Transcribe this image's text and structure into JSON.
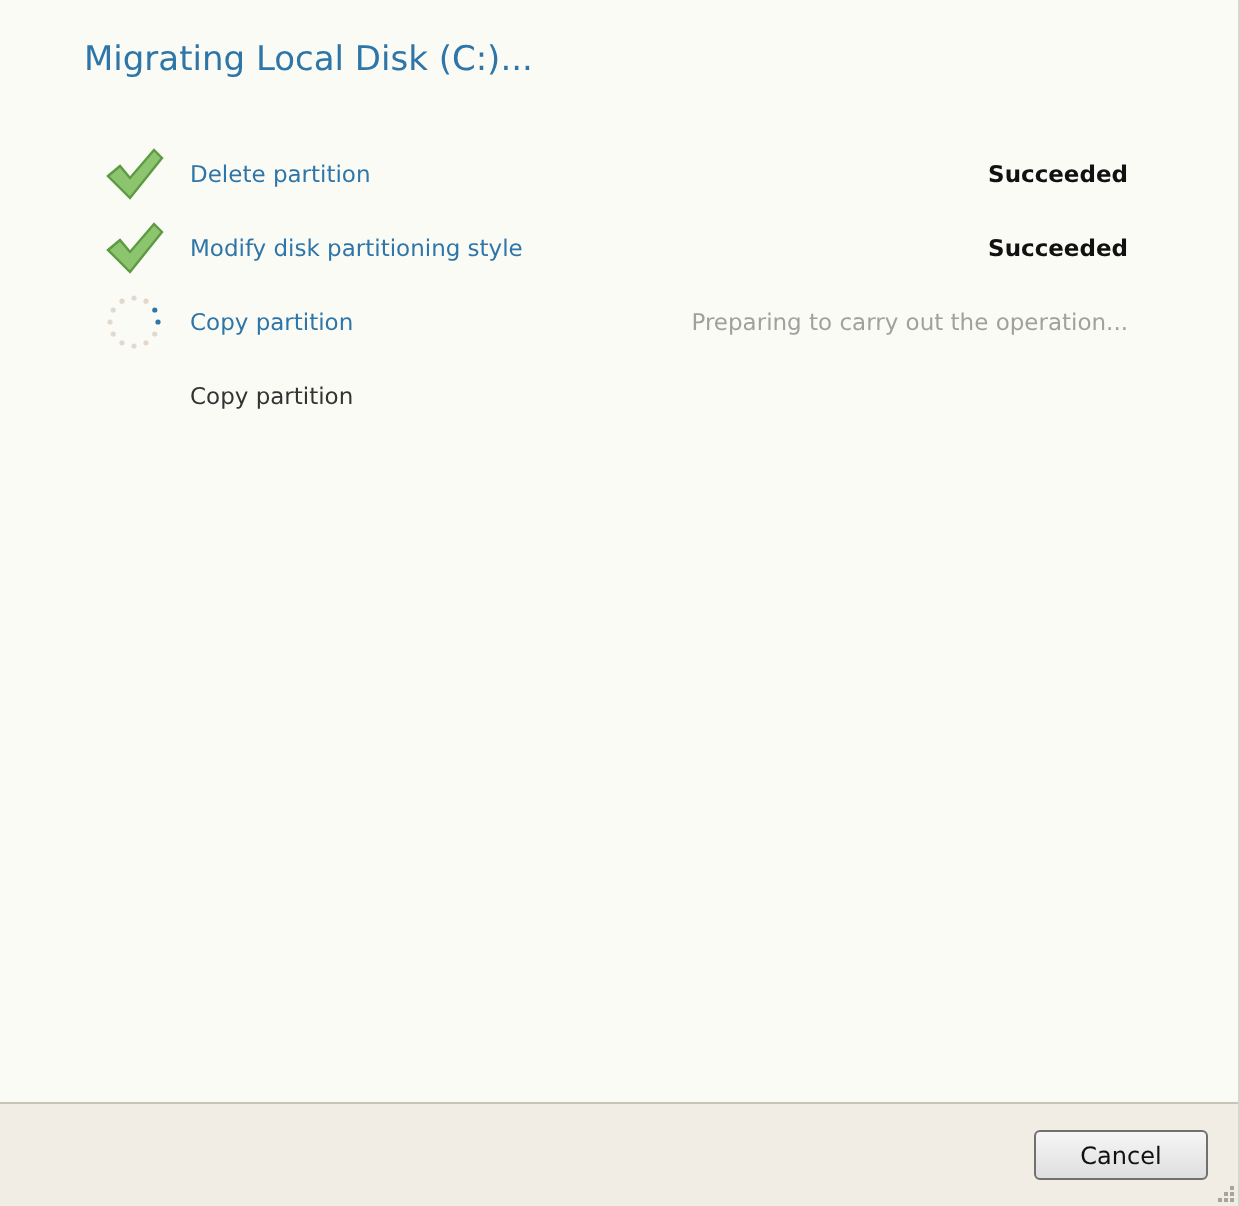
{
  "title": "Migrating Local Disk (C:)...",
  "steps": [
    {
      "kind": "done",
      "label": "Delete partition",
      "status": "Succeeded"
    },
    {
      "kind": "done",
      "label": "Modify disk partitioning style",
      "status": "Succeeded"
    },
    {
      "kind": "running",
      "label": "Copy partition",
      "status": "Preparing to carry out the operation..."
    },
    {
      "kind": "pending",
      "label": "Copy partition"
    }
  ],
  "buttons": [
    "Cancel"
  ]
}
